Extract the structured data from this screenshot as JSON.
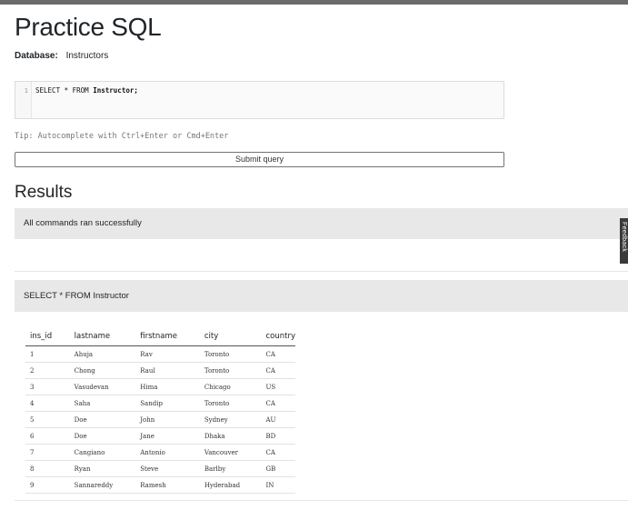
{
  "page": {
    "title": "Practice SQL",
    "database_label": "Database:",
    "database_name": "Instructors"
  },
  "editor": {
    "line_number": "1",
    "code_keyword": "SELECT * FROM ",
    "code_table": "Instructor;"
  },
  "tip": "Tip: Autocomplete with Ctrl+Enter or Cmd+Enter",
  "submit_label": "Submit query",
  "results": {
    "title": "Results",
    "status": "All commands ran successfully",
    "query": "SELECT * FROM Instructor"
  },
  "feedback_label": "Feedback",
  "table": {
    "columns": [
      "ins_id",
      "lastname",
      "firstname",
      "city",
      "country"
    ],
    "rows": [
      [
        "1",
        "Ahuja",
        "Rav",
        "Toronto",
        "CA"
      ],
      [
        "2",
        "Chong",
        "Raul",
        "Toronto",
        "CA"
      ],
      [
        "3",
        "Vasudevan",
        "Hima",
        "Chicago",
        "US"
      ],
      [
        "4",
        "Saha",
        "Sandip",
        "Toronto",
        "CA"
      ],
      [
        "5",
        "Doe",
        "John",
        "Sydney",
        "AU"
      ],
      [
        "6",
        "Doe",
        "Jane",
        "Dhaka",
        "BD"
      ],
      [
        "7",
        "Cangiano",
        "Antonio",
        "Vancouver",
        "CA"
      ],
      [
        "8",
        "Ryan",
        "Steve",
        "Barlby",
        "GB"
      ],
      [
        "9",
        "Sannareddy",
        "Ramesh",
        "Hyderabad",
        "IN"
      ]
    ]
  }
}
